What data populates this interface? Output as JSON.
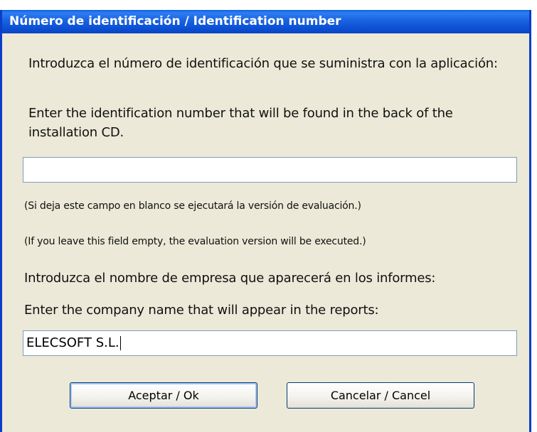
{
  "window": {
    "title": "Número de identificación / Identification number"
  },
  "identification": {
    "prompt_es": "Introduzca el número de identificación que se suministra con la aplicación:",
    "prompt_en": "Enter the identification number that will be found in the back of the installation CD.",
    "value": "",
    "note_es": "(Si deja este campo en blanco se ejecutará la versión de evaluación.)",
    "note_en": "(If you leave this field empty, the evaluation version will be executed.)"
  },
  "company": {
    "prompt_es": "Introduzca el nombre de empresa que aparecerá en los informes:",
    "prompt_en": "Enter the company name that will appear in the reports:",
    "value": "ELECSOFT S.L."
  },
  "buttons": {
    "ok_label": "Aceptar / Ok",
    "cancel_label": "Cancelar / Cancel"
  },
  "colors": {
    "titlebar": "#0b4fd3",
    "dialog_bg": "#ece9d8"
  }
}
